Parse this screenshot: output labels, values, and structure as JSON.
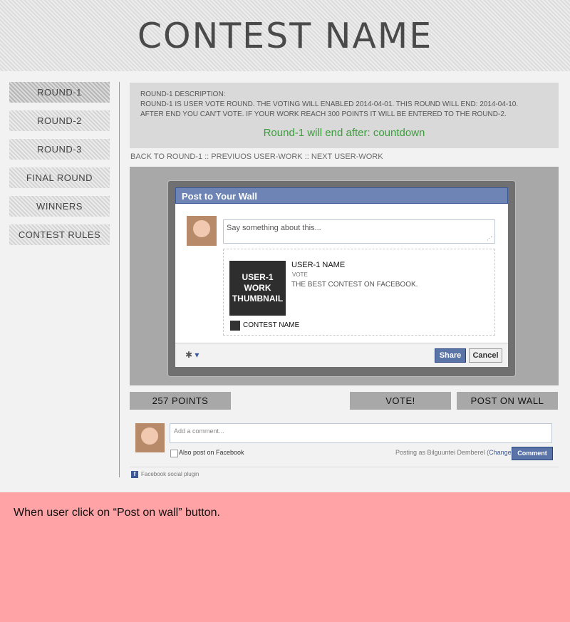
{
  "header": {
    "title": "CONTEST NAME"
  },
  "sidebar": {
    "items": [
      {
        "label": "ROUND-1"
      },
      {
        "label": "ROUND-2"
      },
      {
        "label": "ROUND-3"
      },
      {
        "label": "FINAL ROUND"
      },
      {
        "label": "WINNERS"
      },
      {
        "label": "CONTEST RULES"
      }
    ]
  },
  "description": {
    "heading": "ROUND-1 DESCRIPTION:",
    "line1": "ROUND-1 IS USER VOTE ROUND. THE VOTING WILL ENABLED 2014-04-01.  THIS ROUND WILL END: 2014-04-10.",
    "line2": "AFTER END YOU CAN'T VOTE. IF YOUR WORK REACH 300 POINTS IT WILL BE ENTERED TO THE ROUND-2.",
    "countdown": "Round-1 will end after:  countdown"
  },
  "breadcrumb": {
    "back": "BACK TO ROUND-1",
    "sep": " :: ",
    "prev": "PREVIUOS USER-WORK",
    "next": "NEXT USER-WORK"
  },
  "dialog": {
    "title": "Post to Your Wall",
    "placeholder": "Say something about this...",
    "thumbnail": "USER-1 WORK THUMBNAIL",
    "user_name": "USER-1 NAME",
    "vote_label": "VOTE",
    "description": "THE BEST CONTEST ON FACEBOOK.",
    "site_name": "CONTEST NAME",
    "share": "Share",
    "cancel": "Cancel"
  },
  "actions": {
    "points": "257 POINTS",
    "vote": "VOTE!",
    "post": "POST ON WALL"
  },
  "comments": {
    "placeholder": "Add a comment...",
    "also_post": "Also post on Facebook",
    "posting_as": "Posting as Bilguuntei Demberel",
    "change": "Change",
    "button": "Comment",
    "plugin": "Facebook social plugin"
  },
  "note": "When user click on “Post on wall” button."
}
